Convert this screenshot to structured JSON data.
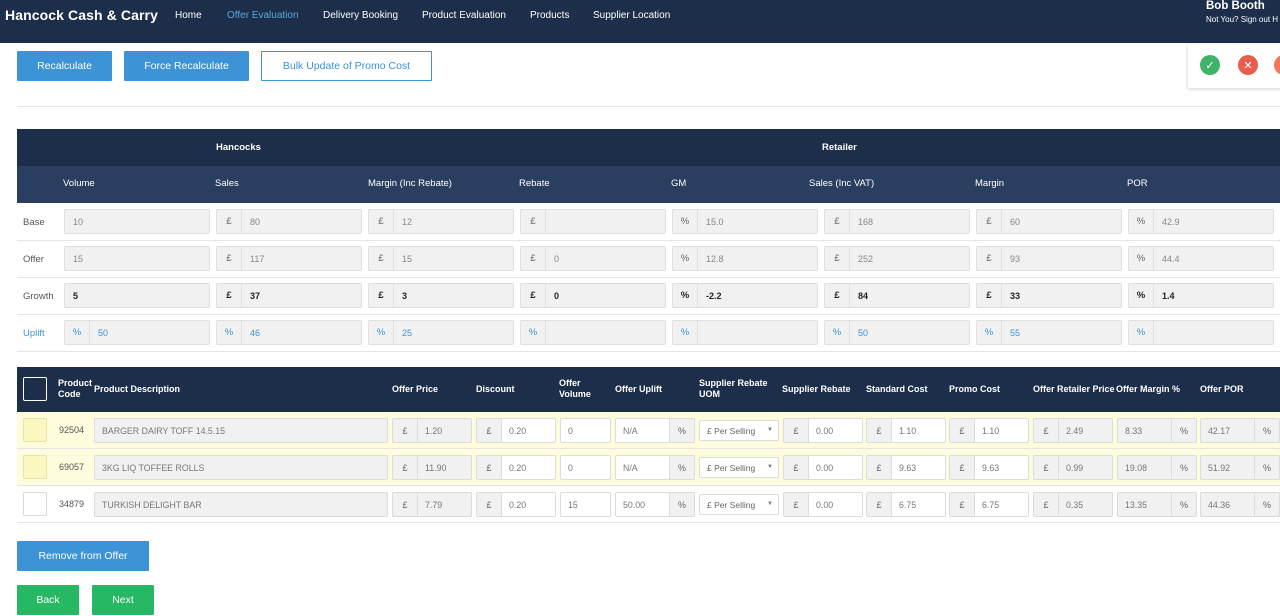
{
  "nav": {
    "brand": "Hancock Cash & Carry",
    "links": [
      "Home",
      "Offer Evaluation",
      "Delivery Booking",
      "Product Evaluation",
      "Products",
      "Supplier Location"
    ],
    "user_name": "Bob Booth",
    "user_sub": "Not You? Sign out H"
  },
  "toolbar": {
    "recalculate": "Recalculate",
    "force_recalculate": "Force Recalculate",
    "bulk_update": "Bulk Update of Promo Cost"
  },
  "status_icons": [
    "check-circle-icon",
    "cross-circle-icon",
    "circle-icon"
  ],
  "colors": {
    "navy": "#1c2e4a",
    "blue": "#3c93d6",
    "green": "#26b862",
    "red": "#e85d50",
    "orange": "#f0795a"
  },
  "summary": {
    "groups": {
      "hancocks": "Hancocks",
      "retailer": "Retailer"
    },
    "columns": [
      "Volume",
      "Sales",
      "Margin (Inc Rebate)",
      "Rebate",
      "GM",
      "Sales (Inc VAT)",
      "Margin",
      "POR"
    ],
    "rows": [
      {
        "label": "Base",
        "cells": [
          [
            "",
            "10"
          ],
          [
            "£",
            "80"
          ],
          [
            "£",
            "12"
          ],
          [
            "£",
            ""
          ],
          [
            "%",
            "15.0"
          ],
          [
            "£",
            "168"
          ],
          [
            "£",
            "60"
          ],
          [
            "%",
            "42.9"
          ]
        ]
      },
      {
        "label": "Offer",
        "cells": [
          [
            "",
            "15"
          ],
          [
            "£",
            "117"
          ],
          [
            "£",
            "15"
          ],
          [
            "£",
            "0"
          ],
          [
            "%",
            "12.8"
          ],
          [
            "£",
            "252"
          ],
          [
            "£",
            "93"
          ],
          [
            "%",
            "44.4"
          ]
        ]
      },
      {
        "label": "Growth",
        "cells": [
          [
            "",
            "5"
          ],
          [
            "£",
            "37"
          ],
          [
            "£",
            "3"
          ],
          [
            "£",
            "0"
          ],
          [
            "%",
            "-2.2"
          ],
          [
            "£",
            "84"
          ],
          [
            "£",
            "33"
          ],
          [
            "%",
            "1.4"
          ]
        ]
      },
      {
        "label": "Uplift",
        "cells": [
          [
            "%",
            "50"
          ],
          [
            "%",
            "46"
          ],
          [
            "%",
            "25"
          ],
          [
            "%",
            ""
          ],
          [
            "%",
            ""
          ],
          [
            "%",
            "50"
          ],
          [
            "%",
            "55"
          ],
          [
            "%",
            ""
          ]
        ]
      }
    ]
  },
  "products": {
    "headers": {
      "code": "Product Code",
      "description": "Product Description",
      "offer_price": "Offer Price",
      "discount": "Discount",
      "offer_volume": "Offer Volume",
      "offer_uplift": "Offer Uplift",
      "rebate_uom": "Supplier Rebate UOM",
      "supplier_rebate": "Supplier Rebate",
      "standard_cost": "Standard Cost",
      "promo_cost": "Promo Cost",
      "retailer_price": "Offer Retailer Price",
      "margin_pct": "Offer Margin %",
      "por": "Offer POR"
    },
    "rows": [
      {
        "code": "92504",
        "description": "BARGER DAIRY TOFF 14.5.15",
        "offer_price": "1.20",
        "discount": "0.20",
        "offer_volume": "0",
        "offer_uplift": "N/A",
        "rebate_uom": "£ Per Selling",
        "supplier_rebate": "0.00",
        "standard_cost": "1.10",
        "promo_cost": "1.10",
        "retailer_price": "2.49",
        "margin_pct": "8.33",
        "por": "42.17",
        "highlight": true
      },
      {
        "code": "69057",
        "description": "3KG LIQ TOFFEE ROLLS",
        "offer_price": "11.90",
        "discount": "0.20",
        "offer_volume": "0",
        "offer_uplift": "N/A",
        "rebate_uom": "£ Per Selling",
        "supplier_rebate": "0.00",
        "standard_cost": "9.63",
        "promo_cost": "9.63",
        "retailer_price": "0.99",
        "margin_pct": "19.08",
        "por": "51.92",
        "highlight": true
      },
      {
        "code": "34879",
        "description": "TURKISH DELIGHT BAR",
        "offer_price": "7.79",
        "discount": "0.20",
        "offer_volume": "15",
        "offer_uplift": "50.00",
        "rebate_uom": "£ Per Selling",
        "supplier_rebate": "0.00",
        "standard_cost": "6.75",
        "promo_cost": "6.75",
        "retailer_price": "0.35",
        "margin_pct": "13.35",
        "por": "44.36",
        "highlight": false
      }
    ],
    "currency": "£",
    "percent": "%"
  },
  "footer": {
    "remove": "Remove from Offer",
    "back": "Back",
    "next": "Next"
  }
}
